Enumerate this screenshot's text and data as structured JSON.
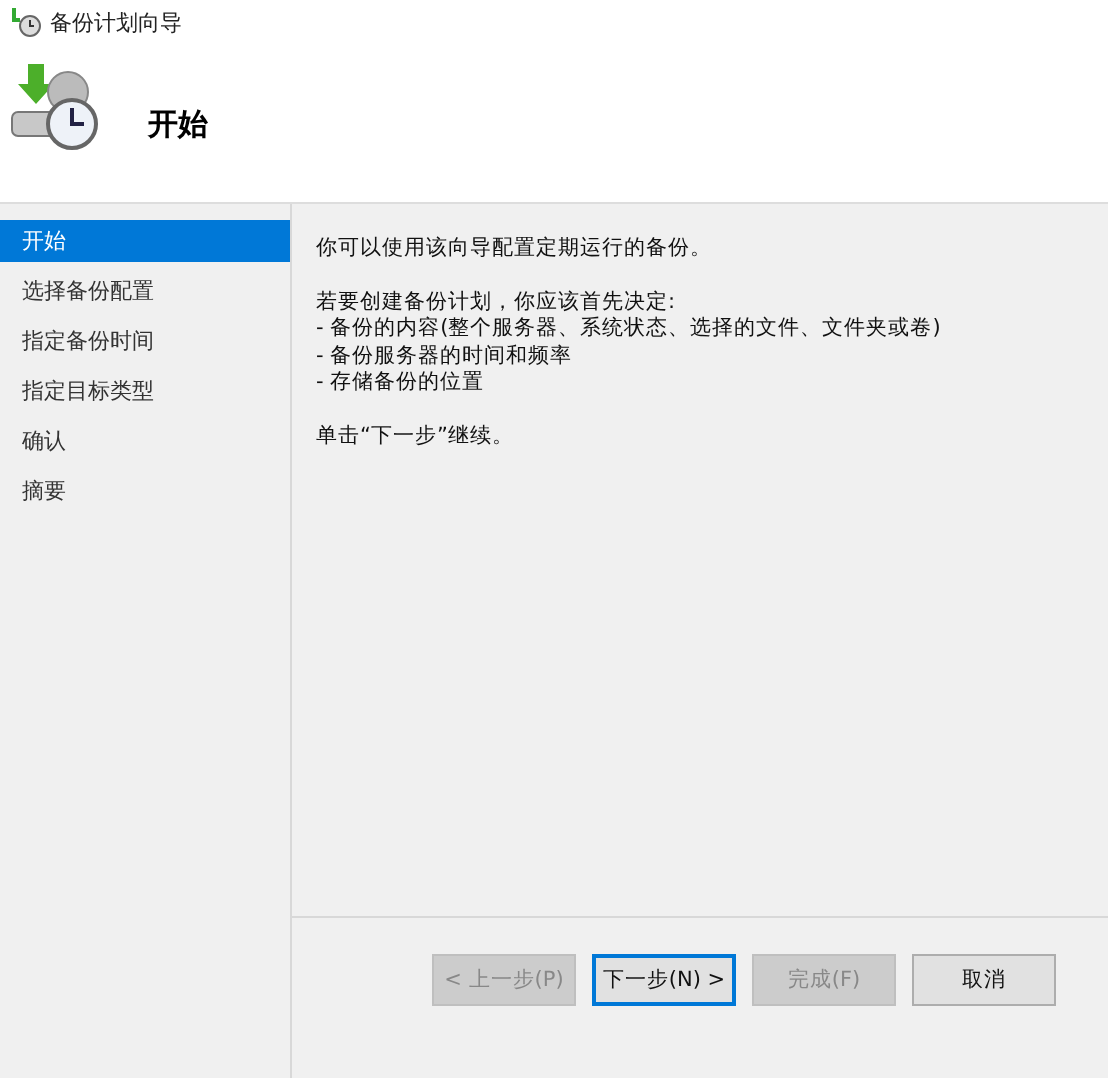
{
  "window": {
    "title": "备份计划向导"
  },
  "header": {
    "title": "开始"
  },
  "steps": [
    {
      "label": "开始",
      "selected": true
    },
    {
      "label": "选择备份配置",
      "selected": false
    },
    {
      "label": "指定备份时间",
      "selected": false
    },
    {
      "label": "指定目标类型",
      "selected": false
    },
    {
      "label": "确认",
      "selected": false
    },
    {
      "label": "摘要",
      "selected": false
    }
  ],
  "content": {
    "paragraphs": [
      [
        "你可以使用该向导配置定期运行的备份。"
      ],
      [
        "若要创建备份计划，你应该首先决定:",
        "- 备份的内容(整个服务器、系统状态、选择的文件、文件夹或卷)",
        "- 备份服务器的时间和频率",
        "- 存储备份的位置"
      ],
      [
        "单击“下一步”继续。"
      ]
    ]
  },
  "buttons": [
    {
      "label": "< 上一步(P)",
      "disabled": true,
      "default": false
    },
    {
      "label": "下一步(N) >",
      "disabled": false,
      "default": true
    },
    {
      "label": "完成(F)",
      "disabled": true,
      "default": false
    },
    {
      "label": "取消",
      "disabled": false,
      "default": false
    }
  ]
}
